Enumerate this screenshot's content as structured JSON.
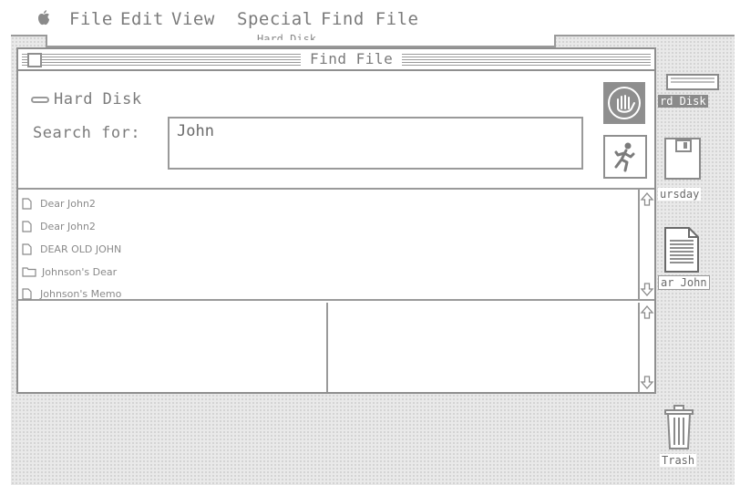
{
  "menubar": {
    "items": [
      "File",
      "Edit",
      "View",
      "Special",
      "Find File"
    ]
  },
  "background_window": {
    "title": "Hard Disk"
  },
  "find_window": {
    "title": "Find File",
    "volume": "Hard Disk",
    "search_label": "Search for:",
    "search_value": "John",
    "results": [
      {
        "name": "Dear John2",
        "icon": "document-icon"
      },
      {
        "name": "Dear John2",
        "icon": "document-icon"
      },
      {
        "name": "DEAR OLD JOHN",
        "icon": "document-icon"
      },
      {
        "name": "Johnson's Dear",
        "icon": "folder-icon"
      },
      {
        "name": "Johnson's Memo",
        "icon": "document-icon"
      }
    ],
    "buttons": {
      "stop": "stop-hand-icon",
      "find": "running-man-icon"
    }
  },
  "desktop": {
    "icons": [
      {
        "label": "rd Disk",
        "icon": "hard-disk-icon"
      },
      {
        "label": "ursday",
        "icon": "floppy-disk-icon"
      },
      {
        "label": "ar John",
        "icon": "document-icon"
      },
      {
        "label": "Trash",
        "icon": "trash-icon"
      }
    ]
  },
  "colors": {
    "chrome_gray": "#8f8f8f",
    "text_gray": "#7b7b7b",
    "desktop_pattern": "#e9e9e9"
  }
}
